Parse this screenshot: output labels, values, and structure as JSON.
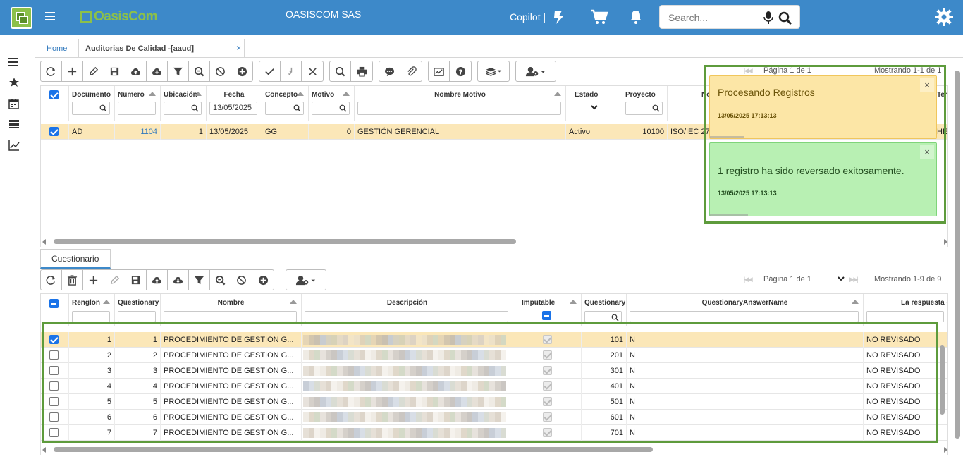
{
  "header": {
    "company": "OASISCOM SAS",
    "brand": "OasisCom",
    "copilot": "Copilot |",
    "search_placeholder": "Search..."
  },
  "tabs": {
    "home": "Home",
    "active": "Auditorias De Calidad -[aaud]",
    "close": "×"
  },
  "top_grid": {
    "pager": {
      "page": "Página 1 de 1",
      "showing": "Mostrando 1-1 de 1"
    },
    "columns": [
      {
        "label": "Documento",
        "filter": ""
      },
      {
        "label": "Numero",
        "filter": ""
      },
      {
        "label": "Ubicación",
        "filter": ""
      },
      {
        "label": "Fecha",
        "filter": "13/05/2025"
      },
      {
        "label": "Concepto",
        "filter": ""
      },
      {
        "label": "Motivo",
        "filter": ""
      },
      {
        "label": "Nombre Motivo",
        "filter": ""
      },
      {
        "label": "Estado",
        "filter": ""
      },
      {
        "label": "Proyecto",
        "filter": ""
      },
      {
        "label": "No",
        "filter": ""
      },
      {
        "label": "Ter",
        "filter": ""
      }
    ],
    "rows": [
      {
        "documento": "AD",
        "numero": "1104",
        "ubicacion": "1",
        "fecha": "13/05/2025",
        "concepto": "GG",
        "motivo": "0",
        "nombre_motivo": "GESTIÓN GERENCIAL",
        "estado": "Activo",
        "proyecto": "10100",
        "norma": "ISO/IEC 27",
        "tercero": "HEN"
      }
    ]
  },
  "toasts": {
    "processing": {
      "message": "Procesando Registros",
      "time": "13/05/2025 17:13:13",
      "close": "×"
    },
    "success": {
      "message": "1 registro ha sido reversado exitosamente.",
      "time": "13/05/2025 17:13:13",
      "close": "×"
    }
  },
  "subtab": "Cuestionario",
  "bottom_grid": {
    "pager": {
      "page": "Página 1 de 1",
      "showing": "Mostrando 1-9 de 9"
    },
    "columns": [
      {
        "label": "Renglon"
      },
      {
        "label": "Questionary"
      },
      {
        "label": "Nombre"
      },
      {
        "label": "Descripción"
      },
      {
        "label": "Imputable"
      },
      {
        "label": "Questionary"
      },
      {
        "label": "QuestionaryAnswerName"
      },
      {
        "label": "La respuesta es"
      }
    ],
    "rows": [
      {
        "renglon": "1",
        "questionary": "1",
        "nombre": "PROCEDIMIENTO DE GESTION G...",
        "answer_id": "101",
        "answer_name": "N",
        "respuesta": "NO REVISADO",
        "selected": true
      },
      {
        "renglon": "2",
        "questionary": "2",
        "nombre": "PROCEDIMIENTO DE GESTION G...",
        "answer_id": "201",
        "answer_name": "N",
        "respuesta": "NO REVISADO",
        "selected": false
      },
      {
        "renglon": "3",
        "questionary": "3",
        "nombre": "PROCEDIMIENTO DE GESTION G...",
        "answer_id": "301",
        "answer_name": "N",
        "respuesta": "NO REVISADO",
        "selected": false
      },
      {
        "renglon": "4",
        "questionary": "4",
        "nombre": "PROCEDIMIENTO DE GESTION G...",
        "answer_id": "401",
        "answer_name": "N",
        "respuesta": "NO REVISADO",
        "selected": false
      },
      {
        "renglon": "5",
        "questionary": "5",
        "nombre": "PROCEDIMIENTO DE GESTION G...",
        "answer_id": "501",
        "answer_name": "N",
        "respuesta": "NO REVISADO",
        "selected": false
      },
      {
        "renglon": "6",
        "questionary": "6",
        "nombre": "PROCEDIMIENTO DE GESTION G...",
        "answer_id": "601",
        "answer_name": "N",
        "respuesta": "NO REVISADO",
        "selected": false
      },
      {
        "renglon": "7",
        "questionary": "7",
        "nombre": "PROCEDIMIENTO DE GESTION G...",
        "answer_id": "701",
        "answer_name": "N",
        "respuesta": "NO REVISADO",
        "selected": false
      }
    ]
  },
  "colors": {
    "topbar": "#3d89c9",
    "brand_green": "#8cc04a",
    "selected_row": "#fbe7b8",
    "toast_warning": "#fce6a6",
    "toast_success": "#b8f0b3",
    "highlight_frame": "#5e9b3c"
  }
}
